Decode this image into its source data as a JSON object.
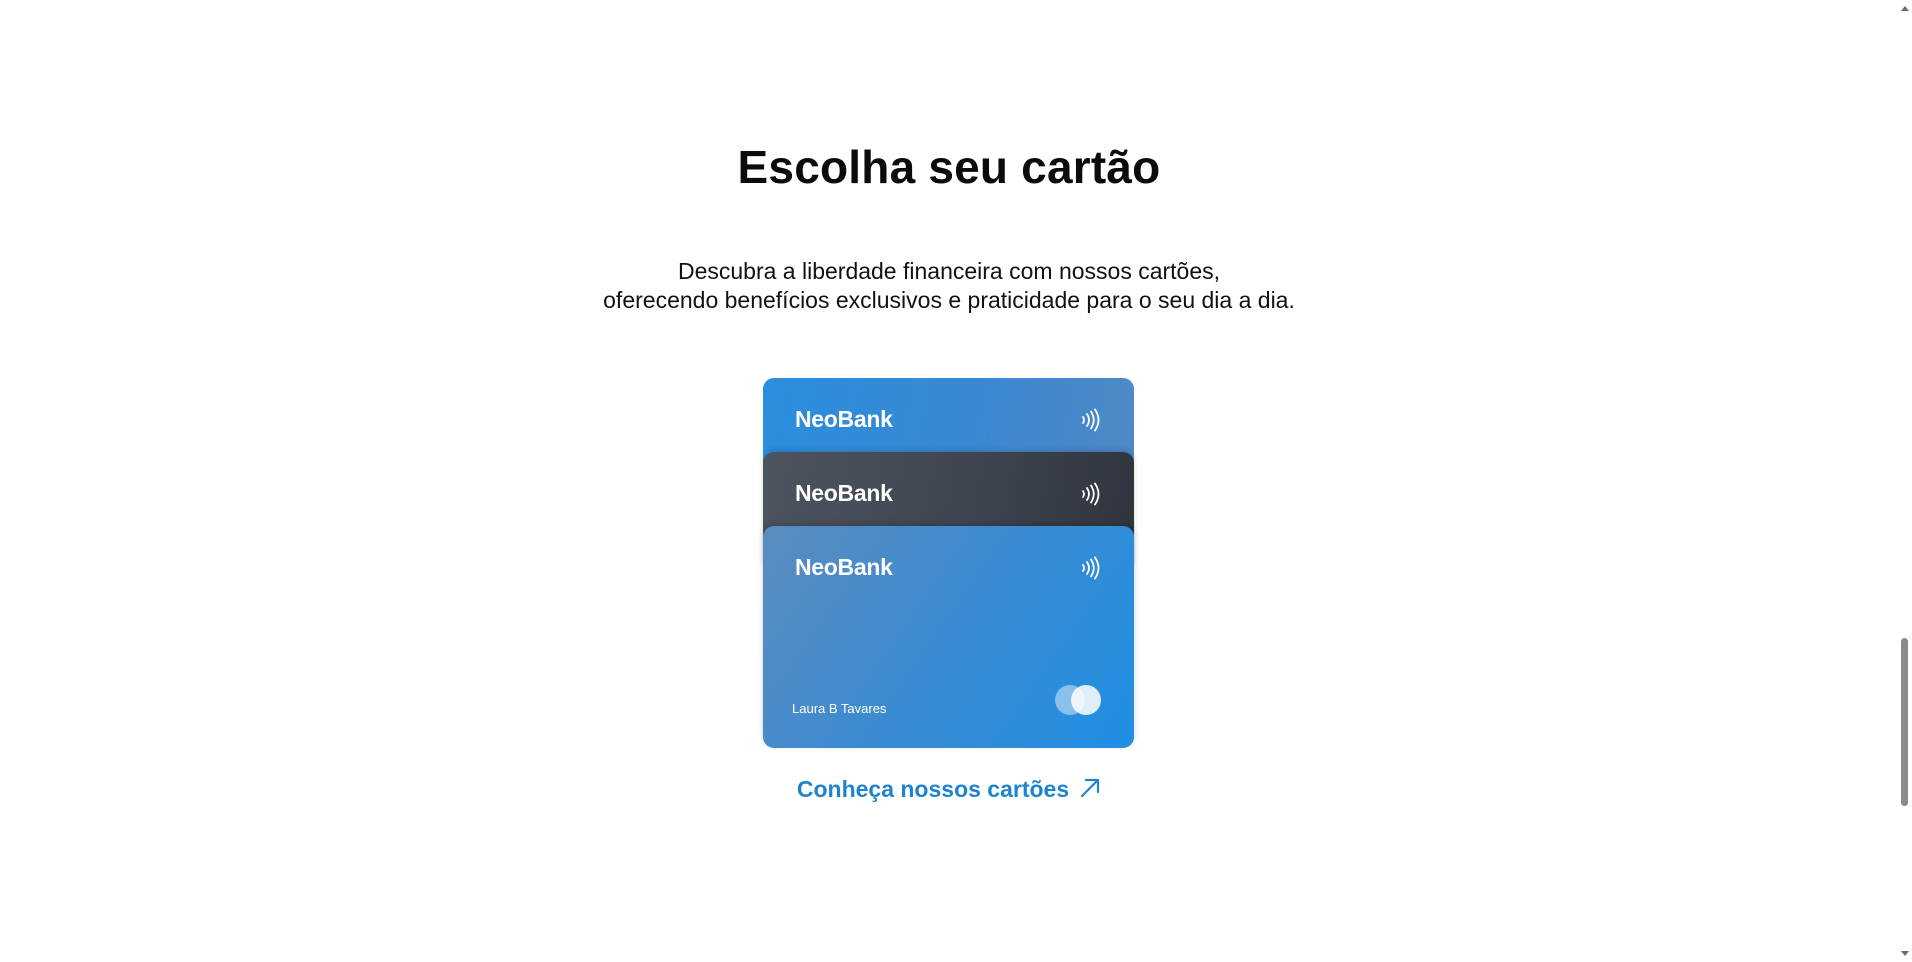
{
  "section": {
    "title": "Escolha seu cartão",
    "description_line1": "Descubra a liberdade financeira com nossos cartões,",
    "description_line2": "oferecendo benefícios exclusivos e praticidade para o seu dia a dia."
  },
  "cards": [
    {
      "brand": "NeoBank",
      "color": "#2a8ee0"
    },
    {
      "brand": "NeoBank",
      "color": "#3f4550"
    },
    {
      "brand": "NeoBank",
      "color": "#3b8bd2",
      "holder_name": "Laura B Tavares"
    }
  ],
  "icons": {
    "contactless": "contactless-icon",
    "card_network": "card-network-logo-icon",
    "link_arrow": "arrow-up-right-icon"
  },
  "cta": {
    "label": "Conheça nossos cartões",
    "color": "#1e84cf"
  }
}
